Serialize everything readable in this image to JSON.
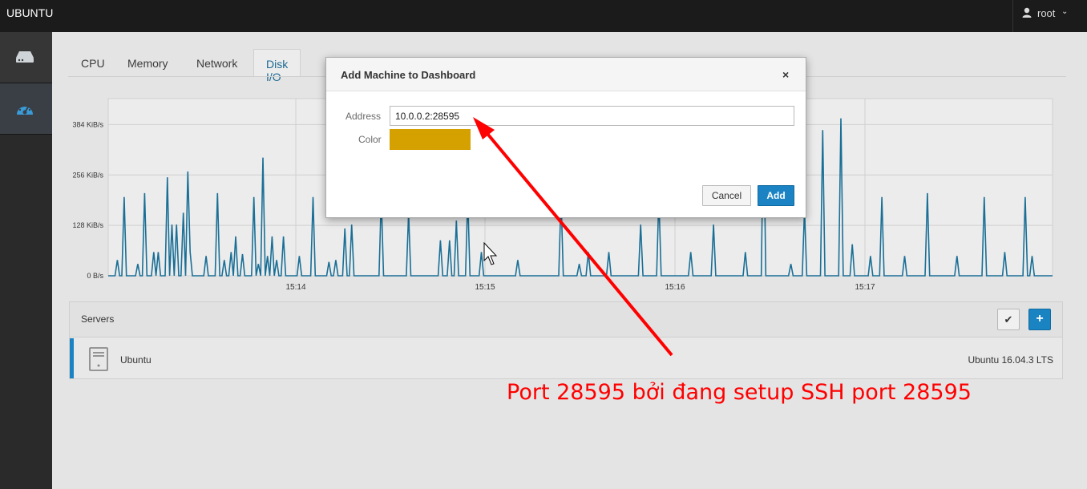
{
  "header": {
    "brand": "UBUNTU",
    "user": "root"
  },
  "sidebar": {
    "items": [
      {
        "icon": "server-icon"
      },
      {
        "icon": "dashboard-icon"
      }
    ]
  },
  "tabs": [
    {
      "label": "CPU",
      "active": false
    },
    {
      "label": "Memory",
      "active": false
    },
    {
      "label": "Network",
      "active": false
    },
    {
      "label": "Disk I/O",
      "active": true
    }
  ],
  "chart_data": {
    "type": "line",
    "ylabel_ticks": [
      "0 B/s",
      "128 KiB/s",
      "256 KiB/s",
      "384 KiB/s"
    ],
    "yticks": [
      0,
      128,
      256,
      384
    ],
    "xticks": [
      "15:14",
      "15:15",
      "15:16",
      "15:17"
    ],
    "ylim": [
      0,
      450
    ],
    "series": [
      {
        "unit": "KiB/s",
        "values": [
          0,
          0,
          0,
          0,
          40,
          0,
          0,
          200,
          0,
          0,
          0,
          0,
          0,
          30,
          0,
          0,
          210,
          0,
          0,
          0,
          60,
          0,
          60,
          0,
          0,
          0,
          250,
          0,
          130,
          0,
          130,
          0,
          0,
          160,
          0,
          265,
          60,
          0,
          0,
          0,
          0,
          0,
          0,
          50,
          0,
          0,
          0,
          0,
          210,
          0,
          0,
          40,
          0,
          0,
          60,
          0,
          100,
          0,
          0,
          55,
          0,
          0,
          0,
          0,
          200,
          0,
          30,
          0,
          300,
          0,
          50,
          0,
          100,
          0,
          40,
          0,
          0,
          100,
          0,
          0,
          0,
          0,
          0,
          0,
          50,
          0,
          0,
          0,
          0,
          0,
          200,
          0,
          0,
          0,
          0,
          0,
          0,
          35,
          0,
          0,
          40,
          0,
          0,
          0,
          120,
          0,
          0,
          130,
          0,
          0,
          0,
          0,
          0,
          0,
          0,
          0,
          0,
          0,
          0,
          0,
          200,
          0,
          0,
          0,
          0,
          0,
          0,
          0,
          0,
          0,
          0,
          0,
          160,
          0,
          0,
          0,
          0,
          0,
          0,
          0,
          0,
          0,
          0,
          0,
          0,
          0,
          90,
          0,
          0,
          0,
          90,
          0,
          0,
          140,
          0,
          0,
          0,
          0,
          200,
          0,
          0,
          0,
          0,
          0,
          60,
          0,
          0,
          0,
          0,
          0,
          0,
          0,
          0,
          0,
          0,
          0,
          0,
          0,
          0,
          0,
          40,
          0,
          0,
          0,
          0,
          0,
          0,
          0,
          0,
          0,
          0,
          0,
          0,
          0,
          0,
          0,
          0,
          0,
          0,
          200,
          0,
          0,
          0,
          0,
          0,
          0,
          0,
          30,
          0,
          0,
          0,
          60,
          0,
          0,
          0,
          0,
          0,
          0,
          0,
          0,
          60,
          0,
          0,
          0,
          0,
          0,
          0,
          0,
          0,
          0,
          0,
          0,
          0,
          0,
          130,
          0,
          0,
          0,
          0,
          0,
          0,
          0,
          200,
          0,
          0,
          0,
          0,
          0,
          0,
          0,
          0,
          0,
          0,
          0,
          0,
          0,
          60,
          0,
          0,
          0,
          0,
          0,
          0,
          0,
          0,
          0,
          130,
          0,
          0,
          0,
          0,
          0,
          0,
          0,
          0,
          0,
          0,
          0,
          0,
          0,
          60,
          0,
          0,
          0,
          0,
          0,
          0,
          0,
          420,
          0,
          0,
          0,
          0,
          0,
          0,
          0,
          0,
          0,
          0,
          0,
          30,
          0,
          0,
          0,
          0,
          0,
          170,
          0,
          0,
          0,
          0,
          0,
          0,
          0,
          370,
          0,
          0,
          0,
          0,
          0,
          0,
          0,
          400,
          0,
          0,
          0,
          0,
          80,
          0,
          0,
          0,
          0,
          0,
          0,
          0,
          50,
          0,
          0,
          0,
          0,
          200,
          0,
          0,
          0,
          0,
          0,
          0,
          0,
          0,
          0,
          50,
          0,
          0,
          0,
          0,
          0,
          0,
          0,
          0,
          0,
          210,
          0,
          0,
          0,
          0,
          0,
          0,
          0,
          0,
          0,
          0,
          0,
          0,
          50,
          0,
          0,
          0,
          0,
          0,
          0,
          0,
          0,
          0,
          0,
          0,
          200,
          0,
          0,
          0,
          0,
          0,
          0,
          0,
          0,
          60,
          0,
          0,
          0,
          0,
          0,
          0,
          0,
          0,
          200,
          0,
          0,
          50,
          0,
          0,
          0,
          0,
          0,
          0,
          0,
          0,
          0
        ]
      }
    ]
  },
  "servers": {
    "title": "Servers",
    "check_icon": "checkmark-icon",
    "add_icon": "plus-icon",
    "rows": [
      {
        "name": "Ubuntu",
        "os": "Ubuntu 16.04.3 LTS"
      }
    ]
  },
  "dialog": {
    "title": "Add Machine to Dashboard",
    "close": "×",
    "address_label": "Address",
    "address_value": "10.0.0.2:28595",
    "color_label": "Color",
    "color_value": "#d4a100",
    "cancel_label": "Cancel",
    "add_label": "Add"
  },
  "annotation": {
    "text": "Port 28595 bởi đang setup SSH port 28595",
    "color": "#ff0000"
  }
}
